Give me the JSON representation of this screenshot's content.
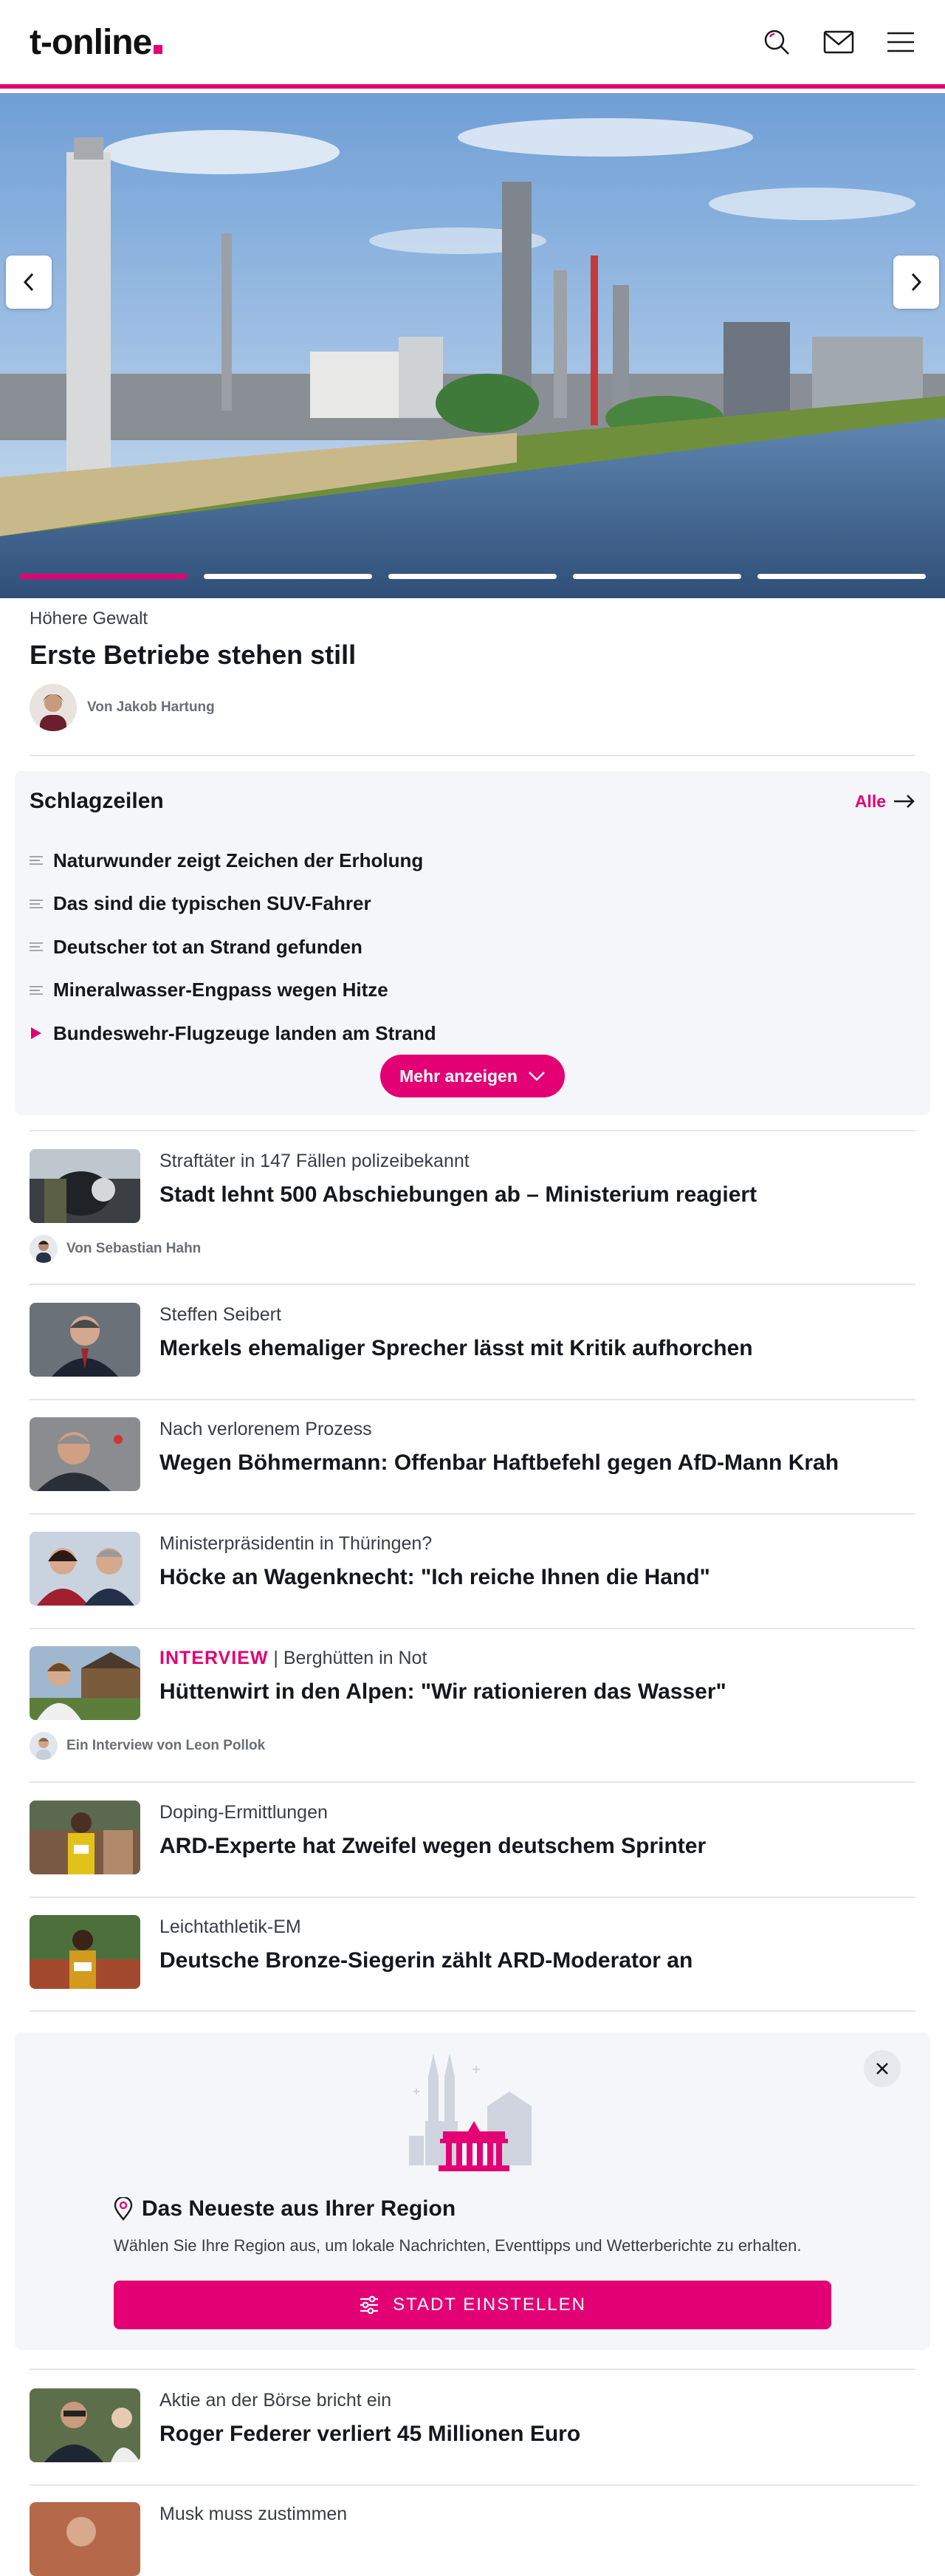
{
  "header": {
    "logo_text": "t-online",
    "icons": [
      "search-icon",
      "mail-icon",
      "menu-icon"
    ]
  },
  "hero": {
    "kicker": "Höhere Gewalt",
    "title": "Erste Betriebe stehen still",
    "author": "Von Jakob Hartung",
    "slides_total": 5,
    "slide_active": 1
  },
  "headlines": {
    "title": "Schlagzeilen",
    "all_label": "Alle",
    "items": [
      "Naturwunder zeigt Zeichen der Erholung",
      "Das sind die typischen SUV-Fahrer",
      "Deutscher tot an Strand gefunden",
      "Mineralwasser-Engpass wegen Hitze",
      "Bundeswehr-Flugzeuge landen am Strand"
    ],
    "more_label": "Mehr anzeigen"
  },
  "articles": [
    {
      "kicker": "Straftäter in 147 Fällen polizeibekannt",
      "title": "Stadt lehnt 500 Abschiebungen ab – Ministerium reagiert",
      "author": "Von Sebastian Hahn"
    },
    {
      "kicker": "Steffen Seibert",
      "title": "Merkels ehemaliger Sprecher lässt mit Kritik aufhorchen"
    },
    {
      "kicker": "Nach verlorenem Prozess",
      "title": "Wegen Böhmermann: Offenbar Haftbefehl gegen AfD-Mann Krah"
    },
    {
      "kicker": "Ministerpräsidentin in Thüringen?",
      "title": "Höcke an Wagenknecht: \"Ich reiche Ihnen die Hand\""
    },
    {
      "label": "INTERVIEW",
      "kicker": "Berghütten in Not",
      "title": "Hüttenwirt in den Alpen: \"Wir rationieren das Wasser\"",
      "author": "Ein Interview von Leon Pollok"
    },
    {
      "kicker": "Doping-Ermittlungen",
      "title": "ARD-Experte hat Zweifel wegen deutschem Sprinter"
    },
    {
      "kicker": "Leichtathletik-EM",
      "title": "Deutsche Bronze-Siegerin zählt ARD-Moderator an"
    },
    {
      "kicker": "Aktie an der Börse bricht ein",
      "title": "Roger Federer verliert 45 Millionen Euro"
    },
    {
      "kicker": "Musk muss zustimmen",
      "title": ""
    }
  ],
  "region": {
    "title": "Das Neueste aus Ihrer Region",
    "description": "Wählen Sie Ihre Region aus, um lokale Nachrichten, Eventtipps und Wetterberichte zu erhalten.",
    "button_label": "STADT EINSTELLEN"
  },
  "colors": {
    "accent": "#e20074",
    "panel": "#f5f6f9",
    "text": "#15171c"
  }
}
